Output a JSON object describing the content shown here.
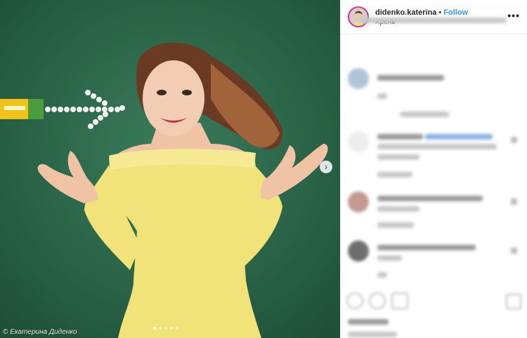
{
  "post": {
    "watermark": "© Екатерина Диденко",
    "next_icon": "chevron-right-icon",
    "carousel_dots": 5,
    "active_dot": 1
  },
  "header": {
    "username": "didenko.katerina",
    "separator": "•",
    "follow_label": "Follow",
    "location": "Хрень",
    "more_icon": "more-horizontal-icon"
  },
  "colors": {
    "follow": "#3897f0",
    "story_ring": "#d6249f",
    "grass": "#2f6b4f",
    "dress": "#f2e27a"
  }
}
